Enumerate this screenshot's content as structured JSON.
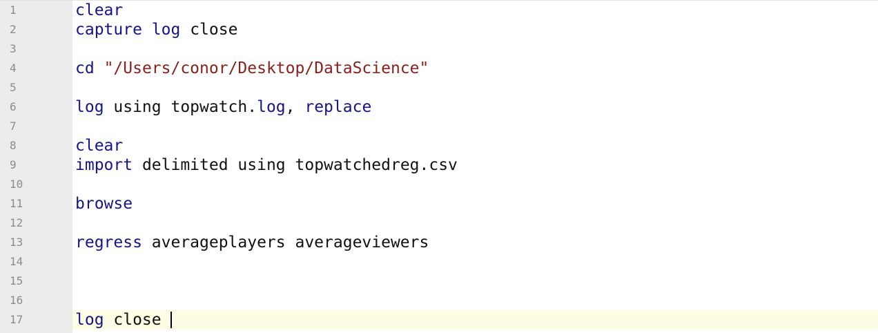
{
  "editor": {
    "line_numbers": [
      "1",
      "2",
      "3",
      "4",
      "5",
      "6",
      "7",
      "8",
      "9",
      "10",
      "11",
      "12",
      "13",
      "14",
      "15",
      "16",
      "17"
    ],
    "current_line": 17,
    "lines": [
      [
        {
          "t": "kw",
          "v": "clear"
        }
      ],
      [
        {
          "t": "kw",
          "v": "capture"
        },
        {
          "t": "plain",
          "v": " "
        },
        {
          "t": "kw",
          "v": "log"
        },
        {
          "t": "plain",
          "v": " close"
        }
      ],
      [],
      [
        {
          "t": "kw",
          "v": "cd"
        },
        {
          "t": "plain",
          "v": " "
        },
        {
          "t": "str",
          "v": "\"/Users/conor/Desktop/DataScience\""
        }
      ],
      [],
      [
        {
          "t": "kw",
          "v": "log"
        },
        {
          "t": "plain",
          "v": " using topwatch."
        },
        {
          "t": "kw",
          "v": "log"
        },
        {
          "t": "plain",
          "v": ", "
        },
        {
          "t": "kw",
          "v": "replace"
        }
      ],
      [],
      [
        {
          "t": "kw",
          "v": "clear"
        }
      ],
      [
        {
          "t": "kw",
          "v": "import"
        },
        {
          "t": "plain",
          "v": " delimited using topwatchedreg.csv"
        }
      ],
      [],
      [
        {
          "t": "kw",
          "v": "browse"
        }
      ],
      [],
      [
        {
          "t": "kw",
          "v": "regress"
        },
        {
          "t": "plain",
          "v": " averageplayers averageviewers"
        }
      ],
      [],
      [],
      [],
      [
        {
          "t": "kw",
          "v": "log"
        },
        {
          "t": "plain",
          "v": " close "
        }
      ]
    ]
  },
  "colors": {
    "keyword": "#14148c",
    "string": "#8a1f1a",
    "plain": "#111111",
    "gutter_bg": "#ececec",
    "gutter_text": "#8b8b8b",
    "current_line_bg": "#fdfde3"
  }
}
